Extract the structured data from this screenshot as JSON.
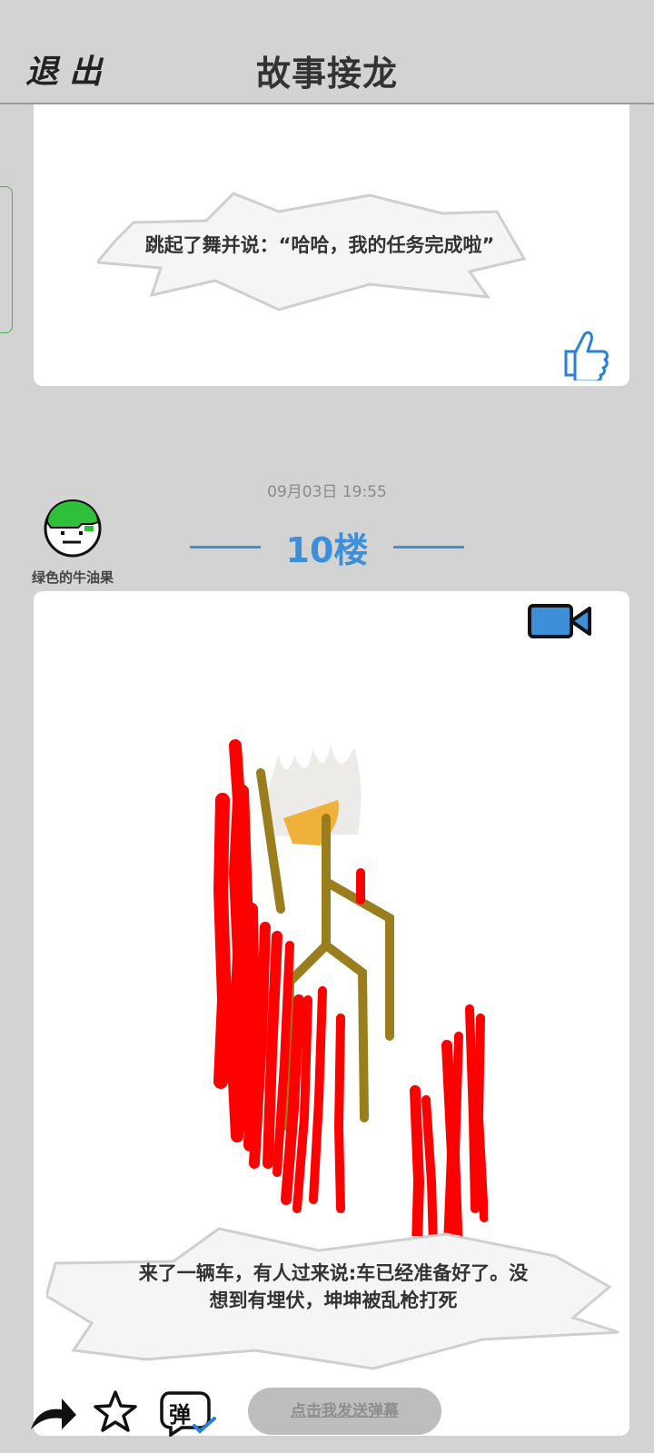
{
  "header": {
    "exit_label": "退出",
    "title": "故事接龙"
  },
  "posts": [
    {
      "caption": "跳起了舞并说：“哈哈，我的任务完成啦”"
    },
    {
      "datetime": "09月03日  19:55",
      "floor": "10楼",
      "username": "绿色的牛油果",
      "caption_line1": "来了一辆车，有人过来说:车已经准备好了。没",
      "caption_line2": "想到有埋伏，坤坤被乱枪打死"
    }
  ],
  "bottom_bar": {
    "danmaku_placeholder": "点击我发送弹幕",
    "danmaku_icon_char": "弹"
  },
  "colors": {
    "background": "#d3d3d3",
    "accent_blue": "#3c8fd8",
    "avatar_green": "#2fbf3a",
    "drawing_red": "#ff0000",
    "drawing_olive": "#9a7d1c"
  },
  "icons": [
    "exit-icon",
    "like-thumb-icon",
    "video-camera-icon",
    "share-icon",
    "star-icon",
    "danmaku-icon"
  ]
}
